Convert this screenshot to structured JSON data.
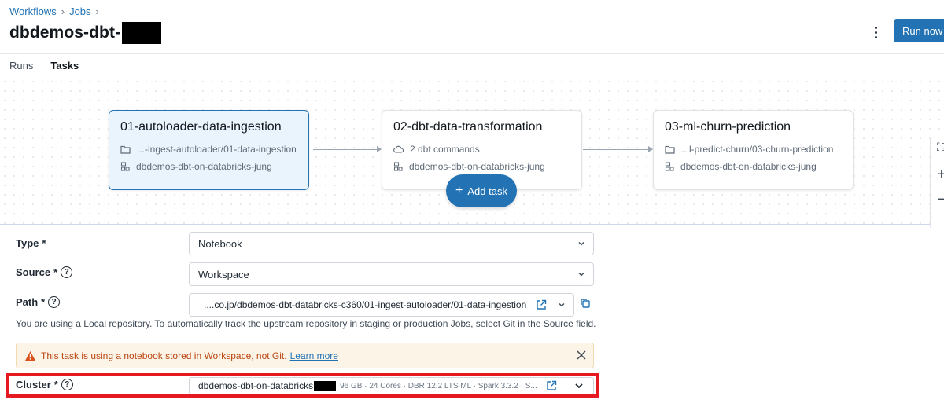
{
  "breadcrumb": {
    "workflows": "Workflows",
    "jobs": "Jobs",
    "separator": "›"
  },
  "header": {
    "title": "dbdemos-dbt-",
    "run_now": "Run now"
  },
  "tabs": [
    {
      "label": "Runs"
    },
    {
      "label": "Tasks"
    }
  ],
  "tasks": [
    {
      "name": "01-autoloader-data-ingestion",
      "path": "...-ingest-autoloader/01-data-ingestion",
      "cluster": "dbdemos-dbt-on-databricks-jung",
      "selected": true
    },
    {
      "name": "02-dbt-data-transformation",
      "path": "2 dbt commands",
      "cluster": "dbdemos-dbt-on-databricks-jung",
      "selected": false
    },
    {
      "name": "03-ml-churn-prediction",
      "path": "...l-predict-churn/03-churn-prediction",
      "cluster": "dbdemos-dbt-on-databricks-jung",
      "selected": false
    }
  ],
  "add_task": {
    "label": "Add task",
    "plus": "+"
  },
  "side_tools": {
    "fit": "⛶",
    "zoom_in": "+",
    "zoom_out": "−"
  },
  "form": {
    "type_label": "Type",
    "type_value": "Notebook",
    "source_label": "Source",
    "source_value": "Workspace",
    "path_label": "Path",
    "path_value": "....co.jp/dbdemos-dbt-databricks-c360/01-ingest-autoloader/01-data-ingestion",
    "required_mark": "*",
    "help": "?",
    "hint": "You are using a Local repository. To automatically track the upstream repository in staging or production Jobs, select Git in the Source field.",
    "warning_text": "This task is using a notebook stored in Workspace, not Git.",
    "warning_link": "Learn more",
    "cluster_label": "Cluster",
    "cluster_name": "dbdemos-dbt-on-databricks",
    "cluster_meta": "96 GB · 24 Cores · DBR 12.2 LTS ML · Spark 3.3.2 · S..."
  },
  "colors": {
    "accent": "#2272b4",
    "warning": "#b9440f",
    "highlight": "#e5191f"
  }
}
